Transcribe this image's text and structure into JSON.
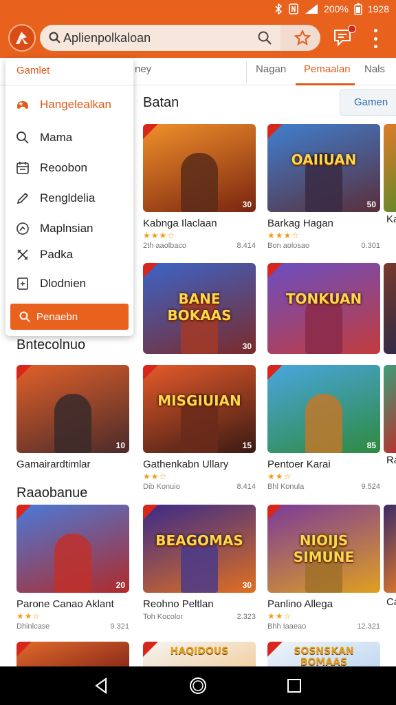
{
  "status_bar": {
    "battery": "200%",
    "time": "1928"
  },
  "search": {
    "value": "Aplienpolkaloan"
  },
  "icons": {
    "app_logo": "app-logo-icon",
    "search": "search-icon",
    "star": "star-icon",
    "messages": "chat-icon",
    "more": "more-vertical-icon"
  },
  "tabs": [
    {
      "label": "ney"
    },
    {
      "label": "Nagan"
    },
    {
      "label": "Pemaalan"
    },
    {
      "label": "Nals"
    }
  ],
  "games_chip": "Gamen",
  "menu": {
    "header": "Gamlet",
    "items": [
      {
        "label": "Hangelealkan",
        "icon": "game-controller-icon"
      },
      {
        "label": "Mama",
        "icon": "search-icon"
      },
      {
        "label": "Reoobon",
        "icon": "calendar-icon"
      },
      {
        "label": "Rengldelia",
        "icon": "pencil-icon"
      },
      {
        "label": "Maplnsian",
        "icon": "refresh-icon"
      },
      {
        "label": "Padka",
        "icon": "tools-icon"
      },
      {
        "label": "Dlodnien",
        "icon": "document-icon"
      }
    ],
    "action": "Penaebn"
  },
  "sections": [
    {
      "title": "Batan"
    },
    {
      "title": "Bntecolnuo"
    },
    {
      "title": "Raaobanue"
    }
  ],
  "cards": [
    {
      "name": "Kabnga Ilaclaan",
      "stars": "★★★☆",
      "installs": "2th aaolbaco",
      "size": "8.414",
      "count": "30",
      "art": "",
      "c1": "#f0902a",
      "c2": "#7a2410",
      "fig": "#5b2b1a"
    },
    {
      "name": "Barkag Hagan",
      "stars": "★★★☆",
      "installs": "Bon aolosao",
      "size": "0.301",
      "count": "50",
      "art": "OAIIUAN",
      "c1": "#3f7fd0",
      "c2": "#5a2e3a",
      "fig": "#3a2a44"
    },
    {
      "name": "",
      "stars": "",
      "installs": "",
      "size": "",
      "count": "30",
      "art": "BANE BOKAAS",
      "c1": "#3c64c8",
      "c2": "#7b2a2a",
      "fig": "#a33a28"
    },
    {
      "name": "",
      "stars": "",
      "installs": "",
      "size": "",
      "count": "",
      "art": "TONKUAN",
      "c1": "#6a4ec2",
      "c2": "#c23c3c",
      "fig": "#8a2a4a"
    },
    {
      "name": "Gamairardtimlar",
      "stars": "",
      "installs": "",
      "size": "",
      "count": "10",
      "art": "",
      "c1": "#e0602a",
      "c2": "#4a2a2a",
      "fig": "#3a2a2a"
    },
    {
      "name": "Gathenkabn Ullary",
      "stars": "★★☆",
      "installs": "Dib Konuio",
      "size": "8.414",
      "count": "15",
      "art": "MISGIUIAN",
      "c1": "#e55a2a",
      "c2": "#3a1a14",
      "fig": "#6a2a1a"
    },
    {
      "name": "Pentoer Karai",
      "stars": "★★☆",
      "installs": "Bhl Konula",
      "size": "9.524",
      "count": "85",
      "art": "",
      "c1": "#49a6e0",
      "c2": "#2e8a3e",
      "fig": "#c0782a"
    },
    {
      "name": "Parone Canao Aklant",
      "stars": "★★☆",
      "installs": "Dhinlcase",
      "size": "9.321",
      "count": "20",
      "art": "",
      "c1": "#4a7ad8",
      "c2": "#b02a2a",
      "fig": "#c0302a"
    },
    {
      "name": "Reohno Peltlan",
      "stars": "",
      "installs": "Toh Kocolor",
      "size": "2.323",
      "count": "30",
      "art": "BEAGOMAS",
      "c1": "#3a2a8a",
      "c2": "#e07020",
      "fig": "#4a3a8a"
    },
    {
      "name": "Panlino Allega",
      "stars": "★★☆",
      "installs": "Bhh Iaaeao",
      "size": "12.321",
      "count": "",
      "art": "NIOIJS SIMUNE",
      "c1": "#7a3a9a",
      "c2": "#e0a020",
      "fig": "#a0702a"
    }
  ],
  "partial_cards": [
    {
      "text": "Ka"
    },
    {
      "text": "Ra"
    },
    {
      "text": "Ca"
    }
  ],
  "bottom_art": [
    {
      "art": "",
      "c1": "#e06a2a",
      "c2": "#8a2a1a"
    },
    {
      "art": "HAQIDOUS",
      "c1": "#f4f4f4",
      "c2": "#f2d0a0"
    },
    {
      "art": "SOSNSKAN BOMAAS",
      "c1": "#f0f4fa",
      "c2": "#c0d8f0"
    }
  ],
  "nav": {
    "back": "back-icon",
    "home": "home-icon",
    "recents": "recents-icon"
  }
}
